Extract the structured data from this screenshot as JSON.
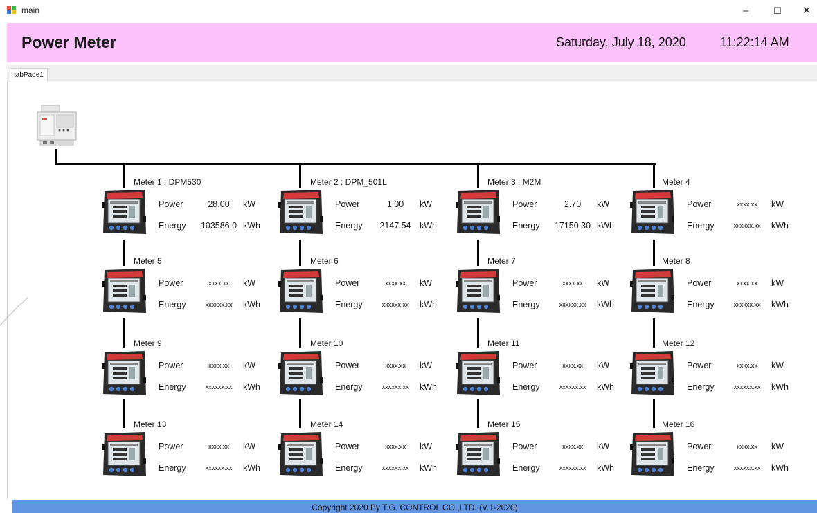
{
  "window": {
    "title": "main",
    "minimize_glyph": "–",
    "maximize_glyph": "☐",
    "close_glyph": "✕"
  },
  "header": {
    "title": "Power Meter",
    "date": "Saturday, July 18, 2020",
    "time": "11:22:14 AM"
  },
  "tabs": [
    {
      "label": "tabPage1"
    }
  ],
  "labels": {
    "power": "Power",
    "energy": "Energy",
    "power_unit": "kW",
    "energy_unit": "kWh"
  },
  "colors": {
    "header_bg": "#fbc2fb",
    "footer_bg": "#5f95e3",
    "bus_line": "#000000"
  },
  "meters": [
    {
      "name": "Meter 1 : DPM530",
      "power": "28.00",
      "energy": "103586.0"
    },
    {
      "name": "Meter 2 : DPM_501L",
      "power": "1.00",
      "energy": "2147.54"
    },
    {
      "name": "Meter 3 : M2M",
      "power": "2.70",
      "energy": "17150.30"
    },
    {
      "name": "Meter 4",
      "power": "xxxx.xx",
      "energy": "xxxxxx.xx"
    },
    {
      "name": "Meter 5",
      "power": "xxxx.xx",
      "energy": "xxxxxx.xx"
    },
    {
      "name": "Meter 6",
      "power": "xxxx.xx",
      "energy": "xxxxxx.xx"
    },
    {
      "name": "Meter 7",
      "power": "xxxx.xx",
      "energy": "xxxxxx.xx"
    },
    {
      "name": "Meter 8",
      "power": "xxxx.xx",
      "energy": "xxxxxx.xx"
    },
    {
      "name": "Meter 9",
      "power": "xxxx.xx",
      "energy": "xxxxxx.xx"
    },
    {
      "name": "Meter 10",
      "power": "xxxx.xx",
      "energy": "xxxxxx.xx"
    },
    {
      "name": "Meter 11",
      "power": "xxxx.xx",
      "energy": "xxxxxx.xx"
    },
    {
      "name": "Meter 12",
      "power": "xxxx.xx",
      "energy": "xxxxxx.xx"
    },
    {
      "name": "Meter 13",
      "power": "xxxx.xx",
      "energy": "xxxxxx.xx"
    },
    {
      "name": "Meter 14",
      "power": "xxxx.xx",
      "energy": "xxxxxx.xx"
    },
    {
      "name": "Meter 15",
      "power": "xxxx.xx",
      "energy": "xxxxxx.xx"
    },
    {
      "name": "Meter 16",
      "power": "xxxx.xx",
      "energy": "xxxxxx.xx"
    }
  ],
  "footer": {
    "copyright": "Copyright 2020 By T.G. CONTROL CO.,LTD. (V.1-2020)"
  }
}
